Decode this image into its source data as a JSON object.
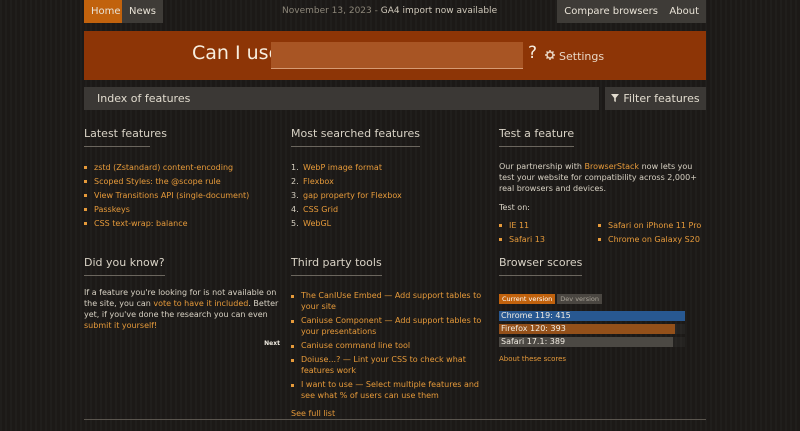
{
  "nav": {
    "home": "Home",
    "news": "News",
    "compare": "Compare browsers",
    "about": "About"
  },
  "announcement": {
    "date": "November 13, 2023",
    "separator": " - ",
    "link": "GA4 import now available"
  },
  "hero": {
    "title": "Can I use",
    "search_value": "",
    "question": "?",
    "settings": "Settings"
  },
  "index": {
    "label": "Index of features",
    "filter": "Filter features"
  },
  "latest": {
    "title": "Latest features",
    "items": [
      "zstd (Zstandard) content-encoding",
      "Scoped Styles: the @scope rule",
      "View Transitions API (single-document)",
      "Passkeys",
      "CSS text-wrap: balance"
    ]
  },
  "most_searched": {
    "title": "Most searched features",
    "items": [
      "WebP image format",
      "Flexbox",
      "gap property for Flexbox",
      "CSS Grid",
      "WebGL"
    ]
  },
  "test": {
    "title": "Test a feature",
    "desc_pre": "Our partnership with ",
    "desc_link": "BrowserStack",
    "desc_post": " now lets you test your website for compatibility across 2,000+ real browsers and devices.",
    "test_on": "Test on:",
    "browsers": [
      "IE 11",
      "Safari 13",
      "Safari on iPhone 11 Pro",
      "Chrome on Galaxy S20"
    ]
  },
  "did_you_know": {
    "title": "Did you know?",
    "text1": "If a feature you're looking for is not available on the site, you can ",
    "link1": "vote to have it included",
    "text2": ". Better yet, if you've done the research you can even ",
    "link2": "submit it yourself!",
    "next": "Next"
  },
  "third_party": {
    "title": "Third party tools",
    "items": [
      "The CanIUse Embed — Add support tables to your site",
      "Caniuse Component — Add support tables to your presentations",
      "Caniuse command line tool",
      "Doiuse...? — Lint your CSS to check what features work",
      "I want to use — Select multiple features and see what % of users can use them"
    ],
    "see_full": "See full list"
  },
  "scores": {
    "title": "Browser scores",
    "current_tag": "Current version",
    "dev_tag": "Dev version",
    "max": 415,
    "bars": [
      {
        "label": "Chrome 119: 415",
        "value": 415,
        "color": "#285891"
      },
      {
        "label": "Firefox 120: 393",
        "value": 393,
        "color": "#93501a"
      },
      {
        "label": "Safari 17.1: 389",
        "value": 389,
        "color": "#4c4944"
      }
    ],
    "about": "About these scores"
  }
}
